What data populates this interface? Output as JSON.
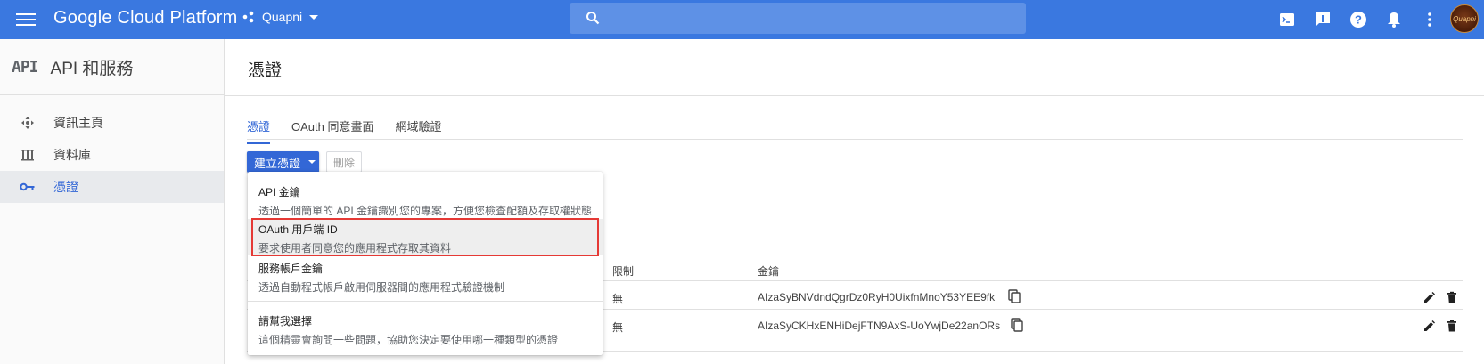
{
  "topbar": {
    "brand": "Google Cloud Platform",
    "project": "Quapni",
    "avatar_text": "Quapni",
    "color": "#3a78e0"
  },
  "sidebar": {
    "logo": "API",
    "title": "API 和服務",
    "items": [
      {
        "label": "資訊主頁",
        "icon": "dashboard-icon"
      },
      {
        "label": "資料庫",
        "icon": "library-icon"
      },
      {
        "label": "憑證",
        "icon": "key-icon",
        "active": true
      }
    ]
  },
  "main": {
    "title": "憑證",
    "tabs": [
      {
        "label": "憑證",
        "active": true
      },
      {
        "label": "OAuth 同意畫面"
      },
      {
        "label": "網域驗證"
      }
    ],
    "create_label": "建立憑證",
    "delete_label": "刪除",
    "table": {
      "headers": {
        "restriction": "限制",
        "key": "金鑰"
      },
      "rows": [
        {
          "restriction": "無",
          "key": "AIzaSyBNVdndQgrDz0RyH0UixfnMnoY53YEE9fk"
        },
        {
          "restriction": "無",
          "key": "AIzaSyCKHxENHiDejFTN9AxS-UoYwjDe22anORs"
        }
      ]
    }
  },
  "dropdown": {
    "items": [
      {
        "title": "API 金鑰",
        "desc": "透過一個簡單的 API 金鑰識別您的專案，方便您檢查配額及存取權狀態"
      },
      {
        "title": "OAuth 用戶端 ID",
        "desc": "要求使用者同意您的應用程式存取其資料",
        "highlighted": true
      },
      {
        "title": "服務帳戶金鑰",
        "desc": "透過自動程式帳戶啟用伺服器間的應用程式驗證機制"
      },
      {
        "title": "請幫我選擇",
        "desc": "這個精靈會詢問一些問題，協助您決定要使用哪一種類型的憑證"
      }
    ]
  }
}
